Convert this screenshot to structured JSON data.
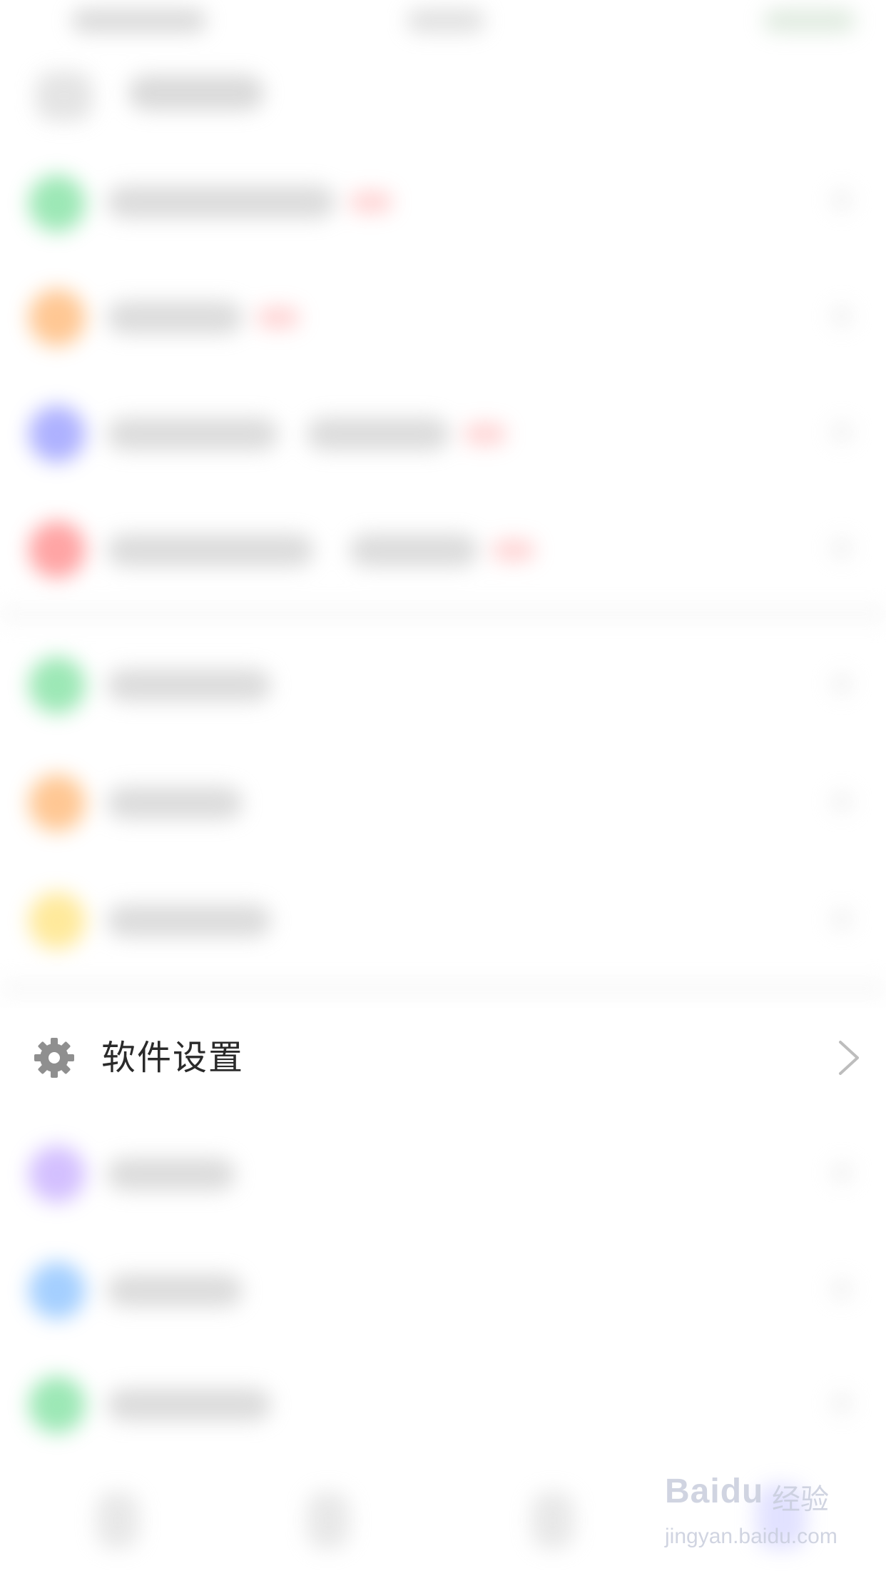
{
  "settings_item": {
    "label": "软件设置",
    "icon": "gear-icon",
    "trailing_icon": "chevron-right-icon"
  },
  "watermark": {
    "logo": "Baidu",
    "cn": "经验",
    "url": "jingyan.baidu.com"
  },
  "colors": {
    "background": "#ffffff",
    "text": "#2a2a2a",
    "icon_gray": "#8f8f8f",
    "chevron": "#bdbdbd",
    "blurred_icons": [
      "#4cd57a",
      "#ff9a3c",
      "#6c72ff",
      "#ff5a5a",
      "#4cd57a",
      "#ff9a3c",
      "#ffd84a",
      "#b08cff",
      "#5aa8ff",
      "#4cd57a"
    ]
  }
}
